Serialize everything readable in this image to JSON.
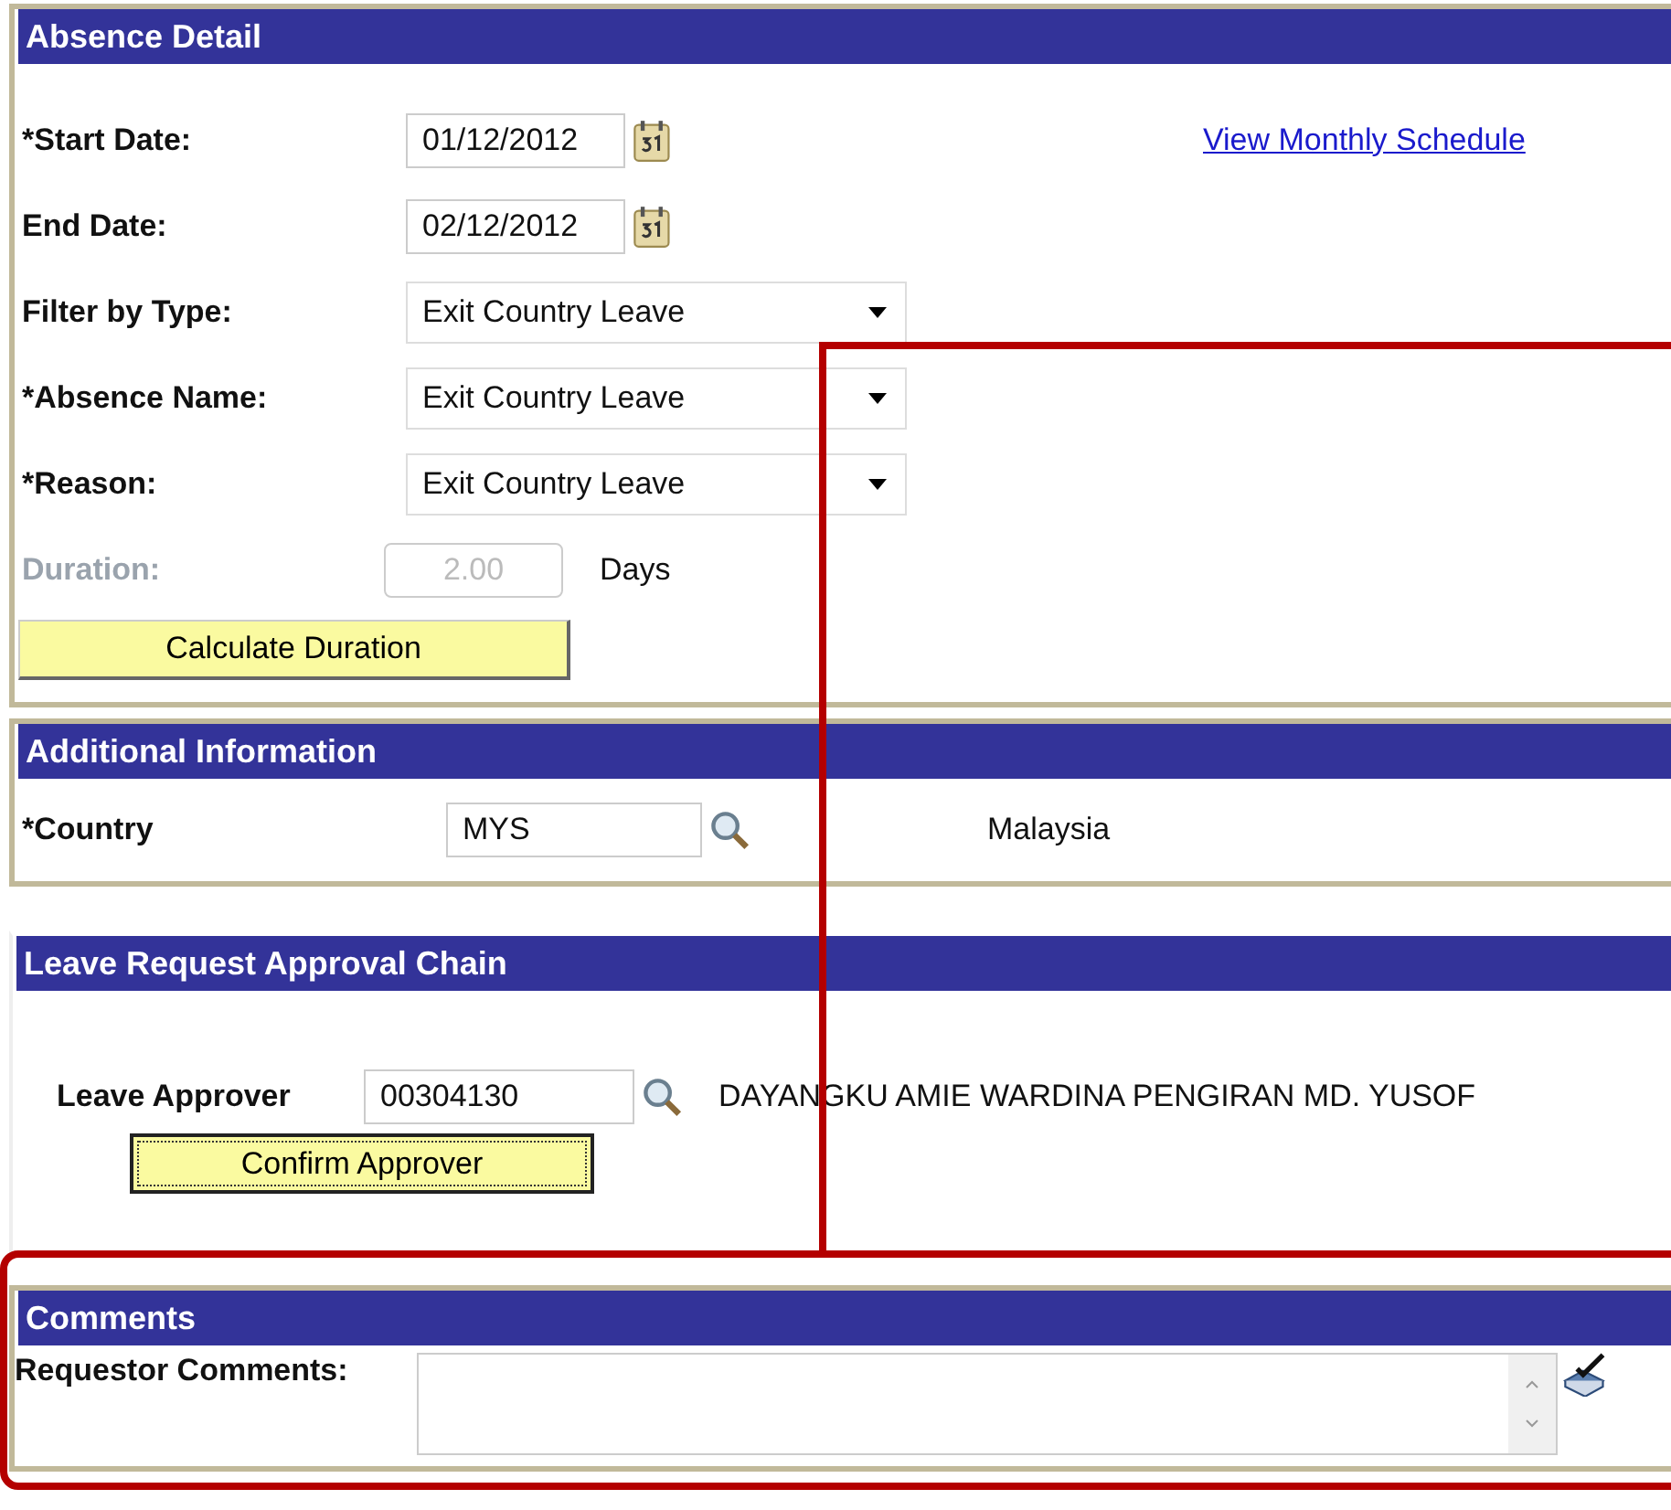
{
  "absence_detail": {
    "title": "Absence Detail",
    "link": "View Monthly Schedule",
    "fields": [
      {
        "kind": "date",
        "label": "*Start Date:",
        "value": "01/12/2012",
        "disabled": false
      },
      {
        "kind": "date",
        "label": "End Date:",
        "value": "02/12/2012",
        "disabled": false
      },
      {
        "kind": "select",
        "label": "Filter by Type:",
        "value": "Exit Country Leave",
        "disabled": false
      },
      {
        "kind": "select",
        "label": "*Absence Name:",
        "value": "Exit Country Leave",
        "disabled": false
      },
      {
        "kind": "select",
        "label": "*Reason:",
        "value": "Exit Country Leave",
        "disabled": false
      },
      {
        "kind": "number",
        "label": "Duration:",
        "value": "2.00",
        "unit": "Days",
        "disabled": true
      }
    ],
    "button": "Calculate Duration"
  },
  "additional_information": {
    "title": "Additional Information",
    "label": "*Country",
    "value": "MYS",
    "description": "Malaysia"
  },
  "approval_chain": {
    "title": "Leave Request Approval Chain",
    "label": "Leave Approver",
    "value": "00304130",
    "approver_name": "DAYANGKU AMIE WARDINA PENGIRAN MD. YUSOF",
    "button": "Confirm Approver"
  },
  "comments": {
    "title": "Comments",
    "label": "Requestor Comments:"
  }
}
